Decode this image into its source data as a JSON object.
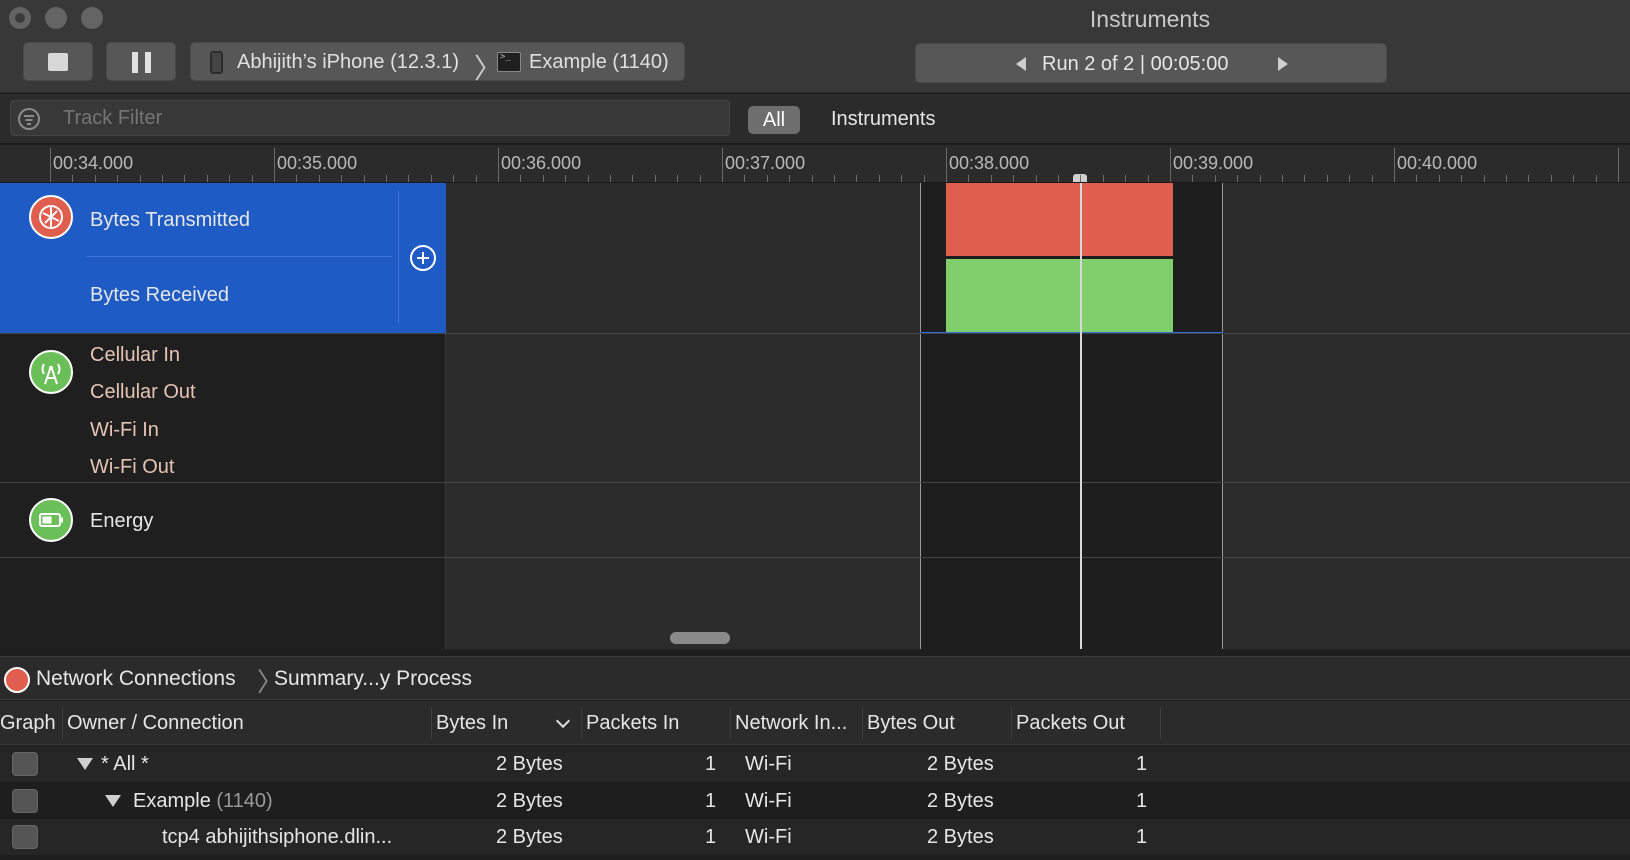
{
  "window": {
    "title": "Instruments"
  },
  "toolbar": {
    "device_name": "Abhijith’s iPhone (12.3.1)",
    "process_name": "Example (1140)",
    "run_label": "Run 2 of 2  |  00:05:00"
  },
  "filter": {
    "placeholder": "Track Filter",
    "scope_all": "All",
    "scope_instruments": "Instruments"
  },
  "ruler": {
    "ticks": [
      "00:34.000",
      "00:35.000",
      "00:36.000",
      "00:37.000",
      "00:38.000",
      "00:39.000",
      "00:40.000"
    ]
  },
  "tracks": {
    "network": {
      "icon": "network-activity-icon",
      "label_primary": "Bytes Transmitted",
      "label_secondary": "Bytes Received",
      "colors": {
        "transmitted": "#e05e4e",
        "received": "#81cf6c",
        "selection": "#1f5bc5"
      }
    },
    "cellular": {
      "icon": "cell-tower-icon",
      "labels": [
        "Cellular In",
        "Cellular Out",
        "Wi-Fi In",
        "Wi-Fi Out"
      ]
    },
    "energy": {
      "icon": "battery-icon",
      "label": "Energy"
    }
  },
  "detail": {
    "breadcrumb": [
      "Network Connections",
      "Summary...y Process"
    ],
    "columns": [
      "Graph",
      "Owner / Connection",
      "Bytes In",
      "Packets In",
      "Network In...",
      "Bytes Out",
      "Packets Out"
    ],
    "rows": [
      {
        "owner": "* All *",
        "owner_suffix": "",
        "bytes_in": "2 Bytes",
        "packets_in": "1",
        "network": "Wi-Fi",
        "bytes_out": "2 Bytes",
        "packets_out": "1"
      },
      {
        "owner": "Example",
        "owner_suffix": "(1140)",
        "bytes_in": "2 Bytes",
        "packets_in": "1",
        "network": "Wi-Fi",
        "bytes_out": "2 Bytes",
        "packets_out": "1"
      },
      {
        "owner": "tcp4 abhijithsiphone.dlin...",
        "owner_suffix": "",
        "bytes_in": "2 Bytes",
        "packets_in": "1",
        "network": "Wi-Fi",
        "bytes_out": "2 Bytes",
        "packets_out": "1"
      }
    ]
  }
}
